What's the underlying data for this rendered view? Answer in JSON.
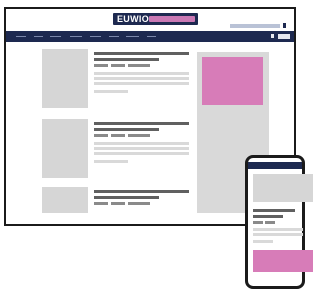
{
  "site": {
    "logo_text": "EUWIO",
    "colors": {
      "brand": "#1d2950",
      "accent": "#c978b4",
      "ad": "#d77cb8",
      "placeholder": "#d6d6d6"
    }
  },
  "nav": {
    "items": [
      "",
      "",
      "",
      "",
      "",
      "",
      "",
      ""
    ],
    "search_icon": "search-icon",
    "menu_icon": "menu-icon"
  },
  "articles": [
    {
      "image": "image-placeholder"
    },
    {
      "image": "image-placeholder"
    },
    {
      "image": "image-placeholder"
    }
  ],
  "sidebar": {
    "ad": "advertisement-block"
  },
  "mobile": {
    "ad": "advertisement-block"
  }
}
